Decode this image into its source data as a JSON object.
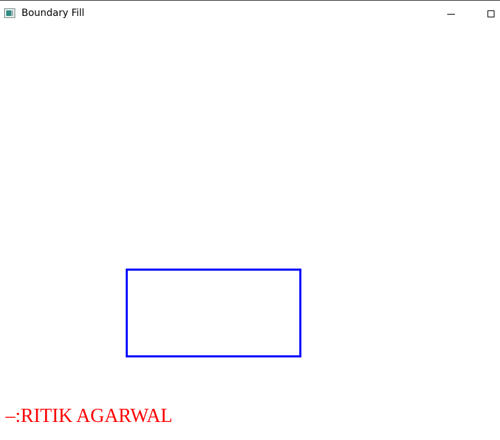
{
  "window": {
    "title": "Boundary Fill",
    "icons": {
      "app": "app-window-icon",
      "minimize": "minimize-icon",
      "maximize": "maximize-icon"
    }
  },
  "canvas": {
    "rectangle_color": "#0000ff",
    "author_color": "#ff0000",
    "author_text": "–:RITIK AGARWAL"
  }
}
